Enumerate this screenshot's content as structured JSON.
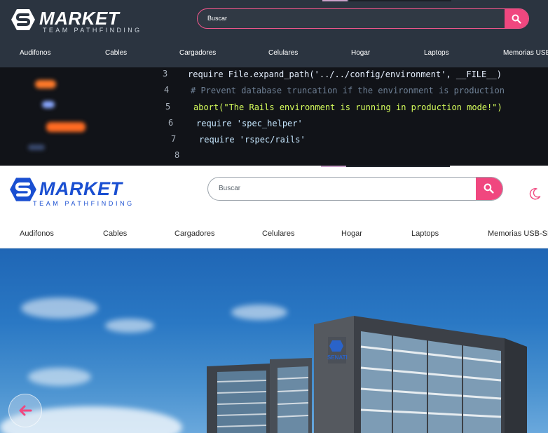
{
  "dark_theme": {
    "logo": {
      "brand": "MARKET",
      "tagline": "TEAM PATHFINDING"
    },
    "search": {
      "placeholder": "Buscar",
      "icon": "search-icon"
    },
    "nav": [
      "Audifonos",
      "Cables",
      "Cargadores",
      "Celulares",
      "Hogar",
      "Laptops",
      "Memorias USB-SD"
    ],
    "code_lines": [
      {
        "n": "3",
        "text": "require File.expand_path('../../config/environment', __FILE__)"
      },
      {
        "n": "4",
        "text": "# Prevent database truncation if the environment is production"
      },
      {
        "n": "5",
        "text": "abort(\"The Rails environment is running in production mode!\")"
      },
      {
        "n": "6",
        "text": "require 'spec_helper'"
      },
      {
        "n": "7",
        "text": "require 'rspec/rails'"
      },
      {
        "n": "8",
        "text": ""
      }
    ]
  },
  "light_theme": {
    "logo": {
      "brand": "MARKET",
      "tagline": "TEAM PATHFINDING"
    },
    "search": {
      "placeholder": "Buscar",
      "icon": "search-icon"
    },
    "theme_toggle_icon": "moon-icon",
    "nav": [
      "Audifonos",
      "Cables",
      "Cargadores",
      "Celulares",
      "Hogar",
      "Laptops",
      "Memorias USB-SD"
    ],
    "hero_sign": "SENATI"
  },
  "floating": {
    "back_icon": "arrow-left-icon"
  },
  "colors": {
    "accent": "#f0477f",
    "brand_blue": "#1a4fd1",
    "dark_bg": "#2b3440"
  }
}
